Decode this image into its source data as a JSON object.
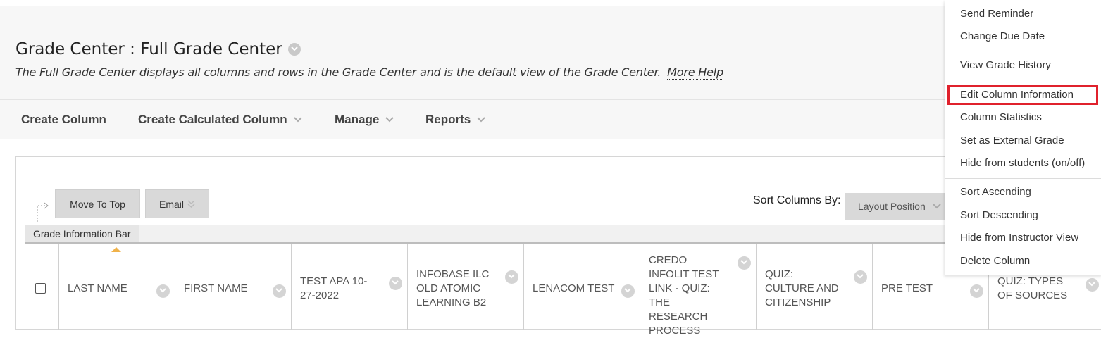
{
  "header": {
    "title": "Grade Center : Full Grade Center",
    "description": "The Full Grade Center displays all columns and rows in the Grade Center and is the default view of the Grade Center.",
    "more_help": "More Help"
  },
  "actions": {
    "create_column": "Create Column",
    "create_calculated_column": "Create Calculated Column",
    "manage": "Manage",
    "reports": "Reports"
  },
  "toolbar": {
    "move_to_top": "Move To Top",
    "email": "Email",
    "sort_columns_by": "Sort Columns By:",
    "sort_value": "Layout Position",
    "grade_info_bar": "Grade Information Bar"
  },
  "columns": [
    {
      "label": "LAST NAME"
    },
    {
      "label": "FIRST NAME"
    },
    {
      "label": "TEST APA 10-27-2022"
    },
    {
      "label": "INFOBASE ILC OLD ATOMIC LEARNING B2"
    },
    {
      "label": "LENACOM TEST"
    },
    {
      "label": "CREDO INFOLIT TEST LINK - QUIZ: THE RESEARCH PROCESS"
    },
    {
      "label": "QUIZ: CULTURE AND CITIZENSHIP"
    },
    {
      "label": "PRE TEST"
    },
    {
      "label": "QUIZ: TYPES OF SOURCES"
    }
  ],
  "menu": {
    "items": [
      "Send Reminder",
      "Change Due Date",
      "View Grade History",
      "Edit Column Information",
      "Column Statistics",
      "Set as External Grade",
      "Hide from students (on/off)",
      "Sort Ascending",
      "Sort Descending",
      "Hide from Instructor View",
      "Delete Column"
    ],
    "highlighted": "Edit Column Information",
    "highlight_color": "#e0212c"
  },
  "icons": {
    "title_menu": "chevron-down-icon",
    "dropdown": "chevron-down-icon",
    "grade_bar_indicator": "caret-up-icon"
  }
}
